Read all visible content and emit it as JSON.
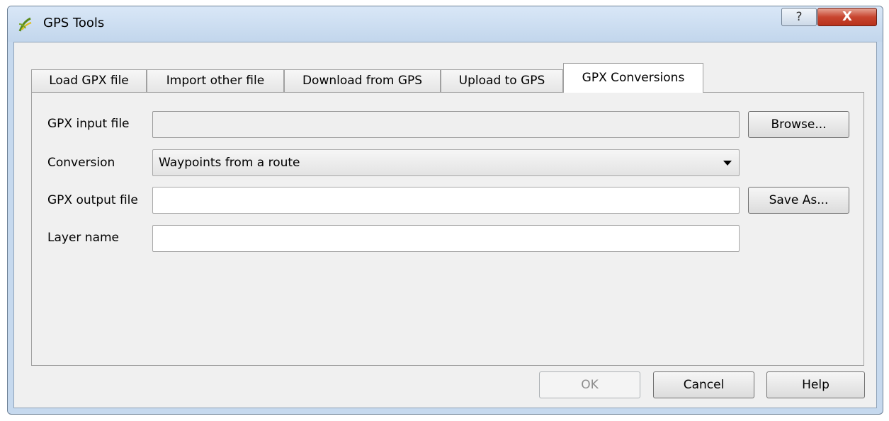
{
  "window": {
    "title": "GPS Tools",
    "app_icon": "qgis-icon",
    "help_button_glyph": "?",
    "close_button_glyph": "X"
  },
  "tabs": [
    {
      "label": "Load GPX file",
      "active": false
    },
    {
      "label": "Import other file",
      "active": false
    },
    {
      "label": "Download from GPS",
      "active": false
    },
    {
      "label": "Upload to GPS",
      "active": false
    },
    {
      "label": "GPX Conversions",
      "active": true
    }
  ],
  "form": {
    "gpx_input_label": "GPX input file",
    "gpx_input_value": "",
    "browse_label": "Browse...",
    "conversion_label": "Conversion",
    "conversion_value": "Waypoints from a route",
    "gpx_output_label": "GPX output file",
    "gpx_output_value": "",
    "save_as_label": "Save As...",
    "layer_name_label": "Layer name",
    "layer_name_value": ""
  },
  "footer": {
    "ok_label": "OK",
    "cancel_label": "Cancel",
    "help_label": "Help"
  }
}
